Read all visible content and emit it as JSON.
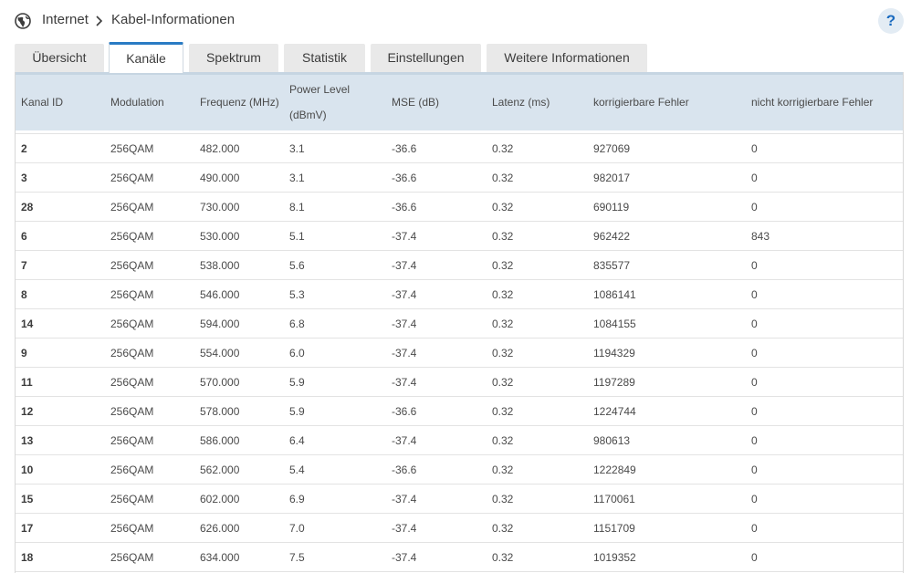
{
  "breadcrumb": {
    "root": "Internet",
    "current": "Kabel-Informationen"
  },
  "help": {
    "label": "?"
  },
  "tabs": [
    {
      "label": "Übersicht",
      "active": false
    },
    {
      "label": "Kanäle",
      "active": true
    },
    {
      "label": "Spektrum",
      "active": false
    },
    {
      "label": "Statistik",
      "active": false
    },
    {
      "label": "Einstellungen",
      "active": false
    },
    {
      "label": "Weitere Informationen",
      "active": false
    }
  ],
  "table": {
    "headers": {
      "kanal_id": "Kanal ID",
      "modulation": "Modulation",
      "frequenz": "Frequenz (MHz)",
      "power_line1": "Power Level",
      "power_line2": "(dBmV)",
      "mse": "MSE (dB)",
      "latenz": "Latenz (ms)",
      "korr": "korrigierbare Fehler",
      "nicht_korr": "nicht korrigierbare Fehler"
    },
    "rows": [
      {
        "id": "2",
        "modulation": "256QAM",
        "freq": "482.000",
        "power": "3.1",
        "mse": "-36.6",
        "latenz": "0.32",
        "korr": "927069",
        "nicht_korr": "0"
      },
      {
        "id": "3",
        "modulation": "256QAM",
        "freq": "490.000",
        "power": "3.1",
        "mse": "-36.6",
        "latenz": "0.32",
        "korr": "982017",
        "nicht_korr": "0"
      },
      {
        "id": "28",
        "modulation": "256QAM",
        "freq": "730.000",
        "power": "8.1",
        "mse": "-36.6",
        "latenz": "0.32",
        "korr": "690119",
        "nicht_korr": "0"
      },
      {
        "id": "6",
        "modulation": "256QAM",
        "freq": "530.000",
        "power": "5.1",
        "mse": "-37.4",
        "latenz": "0.32",
        "korr": "962422",
        "nicht_korr": "843"
      },
      {
        "id": "7",
        "modulation": "256QAM",
        "freq": "538.000",
        "power": "5.6",
        "mse": "-37.4",
        "latenz": "0.32",
        "korr": "835577",
        "nicht_korr": "0"
      },
      {
        "id": "8",
        "modulation": "256QAM",
        "freq": "546.000",
        "power": "5.3",
        "mse": "-37.4",
        "latenz": "0.32",
        "korr": "1086141",
        "nicht_korr": "0"
      },
      {
        "id": "14",
        "modulation": "256QAM",
        "freq": "594.000",
        "power": "6.8",
        "mse": "-37.4",
        "latenz": "0.32",
        "korr": "1084155",
        "nicht_korr": "0"
      },
      {
        "id": "9",
        "modulation": "256QAM",
        "freq": "554.000",
        "power": "6.0",
        "mse": "-37.4",
        "latenz": "0.32",
        "korr": "1194329",
        "nicht_korr": "0"
      },
      {
        "id": "11",
        "modulation": "256QAM",
        "freq": "570.000",
        "power": "5.9",
        "mse": "-37.4",
        "latenz": "0.32",
        "korr": "1197289",
        "nicht_korr": "0"
      },
      {
        "id": "12",
        "modulation": "256QAM",
        "freq": "578.000",
        "power": "5.9",
        "mse": "-36.6",
        "latenz": "0.32",
        "korr": "1224744",
        "nicht_korr": "0"
      },
      {
        "id": "13",
        "modulation": "256QAM",
        "freq": "586.000",
        "power": "6.4",
        "mse": "-37.4",
        "latenz": "0.32",
        "korr": "980613",
        "nicht_korr": "0"
      },
      {
        "id": "10",
        "modulation": "256QAM",
        "freq": "562.000",
        "power": "5.4",
        "mse": "-36.6",
        "latenz": "0.32",
        "korr": "1222849",
        "nicht_korr": "0"
      },
      {
        "id": "15",
        "modulation": "256QAM",
        "freq": "602.000",
        "power": "6.9",
        "mse": "-37.4",
        "latenz": "0.32",
        "korr": "1170061",
        "nicht_korr": "0"
      },
      {
        "id": "17",
        "modulation": "256QAM",
        "freq": "626.000",
        "power": "7.0",
        "mse": "-37.4",
        "latenz": "0.32",
        "korr": "1151709",
        "nicht_korr": "0"
      },
      {
        "id": "18",
        "modulation": "256QAM",
        "freq": "634.000",
        "power": "7.5",
        "mse": "-37.4",
        "latenz": "0.32",
        "korr": "1019352",
        "nicht_korr": "0"
      }
    ]
  },
  "icons": {
    "globe": "globe-icon",
    "breadcrumb_separator": "chevron-right-icon",
    "help": "help-icon"
  },
  "colors": {
    "accent": "#2a7bc4",
    "header_bg": "#d9e4ee",
    "tab_bg": "#e9e9e9",
    "help_bg": "#e3ecf4",
    "help_fg": "#1b6bbf"
  }
}
